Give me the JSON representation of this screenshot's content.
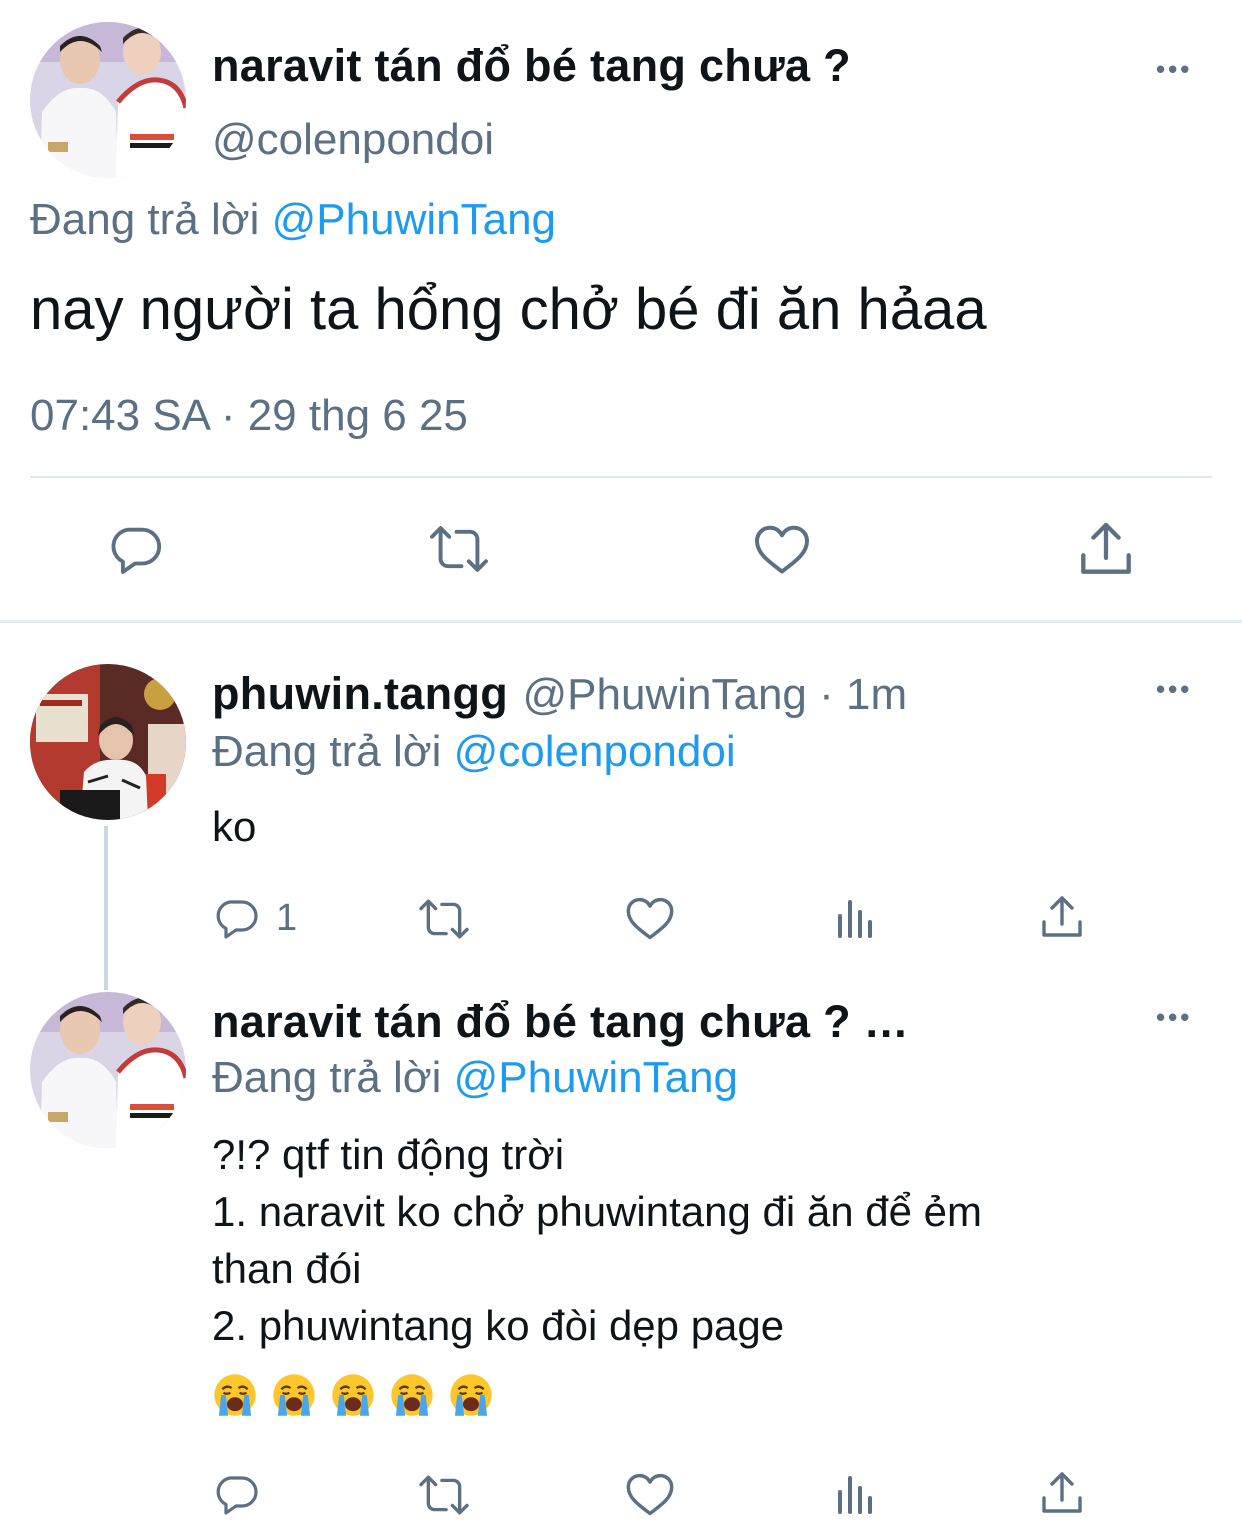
{
  "main_tweet": {
    "display_name": "naravit tán đổ bé tang chưa ?",
    "handle": "@colenpondoi",
    "replying_prefix": "Đang trả lời",
    "replying_to": "@PhuwinTang",
    "text": "nay người ta hổng chở bé đi ăn hảaa",
    "timestamp": "07:43 SA · 29 thg 6 25",
    "more_label": "•••",
    "actions": [
      "reply-icon",
      "retweet-icon",
      "like-icon",
      "share-icon"
    ]
  },
  "replies": [
    {
      "display_name": "phuwin.tangg",
      "meta": "@PhuwinTang · 1m",
      "replying_prefix": "Đang trả lời",
      "replying_to": "@colenpondoi",
      "text": "ko",
      "reply_count": "1",
      "more_label": "•••",
      "actions": [
        "reply-icon",
        "retweet-icon",
        "like-icon",
        "analytics-icon",
        "share-icon"
      ]
    },
    {
      "display_name": "naravit tán đổ bé tang chưa ? …",
      "replying_prefix": "Đang trả lời",
      "replying_to": "@PhuwinTang",
      "text_lines": [
        "?!? qtf tin động trời",
        "1. naravit ko chở phuwintang đi ăn để ẻm",
        "than đói",
        "2. phuwintang ko đòi dẹp page"
      ],
      "emojis": [
        "crying-face-emoji",
        "crying-face-emoji",
        "crying-face-emoji",
        "crying-face-emoji",
        "crying-face-emoji"
      ],
      "more_label": "•••",
      "actions": [
        "reply-icon",
        "retweet-icon",
        "like-icon",
        "analytics-icon",
        "share-icon"
      ]
    }
  ],
  "colors": {
    "text": "#0f1419",
    "secondary": "#5b7083",
    "link": "#1d9bf0",
    "divider": "#e1e8ed"
  }
}
